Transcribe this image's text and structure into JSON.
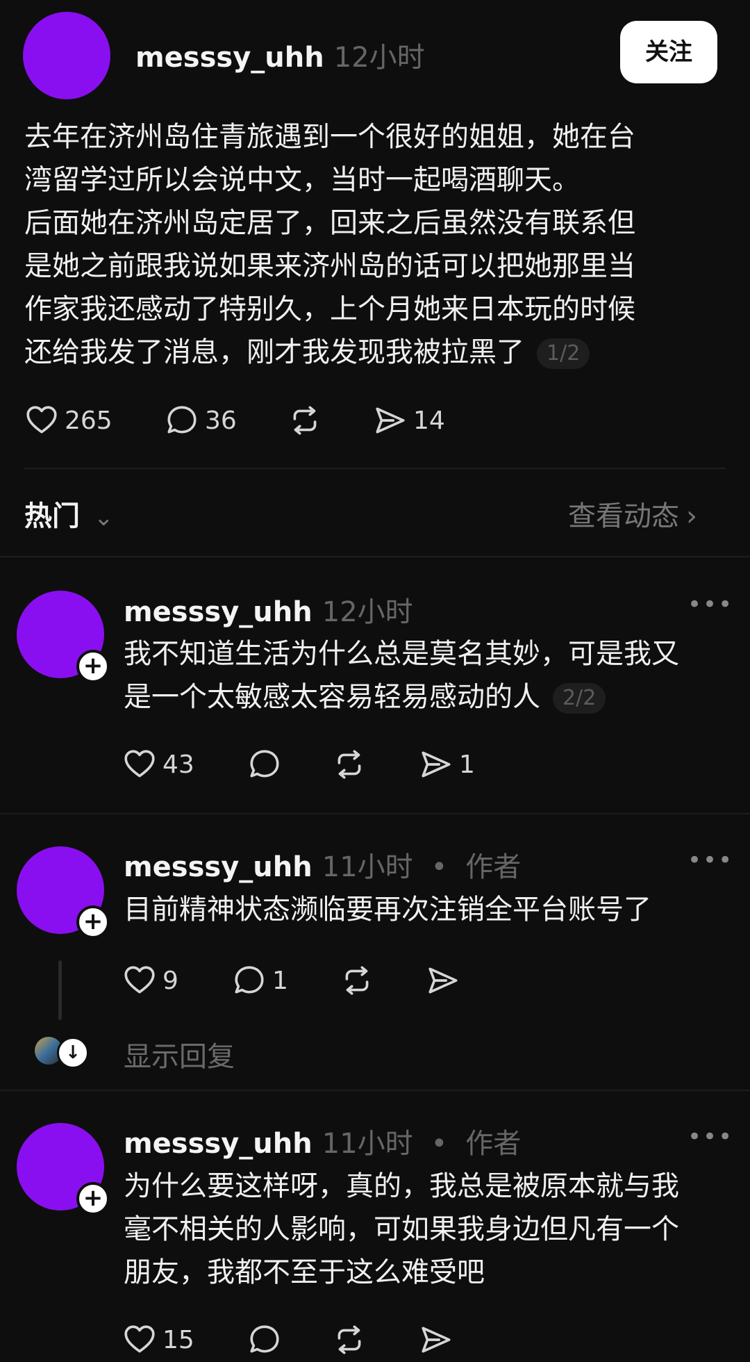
{
  "post": {
    "username": "messsy_uhh",
    "time": "12小时",
    "follow_label": "关注",
    "lines": [
      "去年在济州岛住青旅遇到一个很好的姐姐，她在台",
      "湾留学过所以会说中文，当时一起喝酒聊天。",
      "后面她在济州岛定居了，回来之后虽然没有联系但",
      "是她之前跟我说如果来济州岛的话可以把她那里当",
      "作家我还感动了特别久，上个月她来日本玩的时候",
      "还给我发了消息，刚才我发现我被拉黑了"
    ],
    "pager": "1/2",
    "likes": "265",
    "comments": "36",
    "shares": "14"
  },
  "sort_bar": {
    "label": "热门",
    "view_activity": "查看动态"
  },
  "replies": [
    {
      "username": "messsy_uhh",
      "time": "12小时",
      "author_tag": "",
      "lines": [
        "我不知道生活为什么总是莫名其妙，可是我又",
        "是一个太敏感太容易轻易感动的人"
      ],
      "pager": "2/2",
      "likes": "43",
      "comments": "",
      "shares": "1"
    },
    {
      "username": "messsy_uhh",
      "time": "11小时",
      "author_tag": "作者",
      "lines": [
        "目前精神状态濒临要再次注销全平台账号了"
      ],
      "pager": "",
      "likes": "9",
      "comments": "1",
      "shares": "",
      "show_replies": "显示回复"
    },
    {
      "username": "messsy_uhh",
      "time": "11小时",
      "author_tag": "作者",
      "lines": [
        "为什么要这样呀，真的，我总是被原本就与我",
        "毫不相关的人影响，可如果我身边但凡有一个",
        "朋友，我都不至于这么难受吧"
      ],
      "pager": "",
      "likes": "15",
      "comments": "",
      "shares": ""
    }
  ],
  "colors": {
    "avatar": "#8a0ff0",
    "background": "#0e0e0e",
    "muted": "#666666"
  }
}
